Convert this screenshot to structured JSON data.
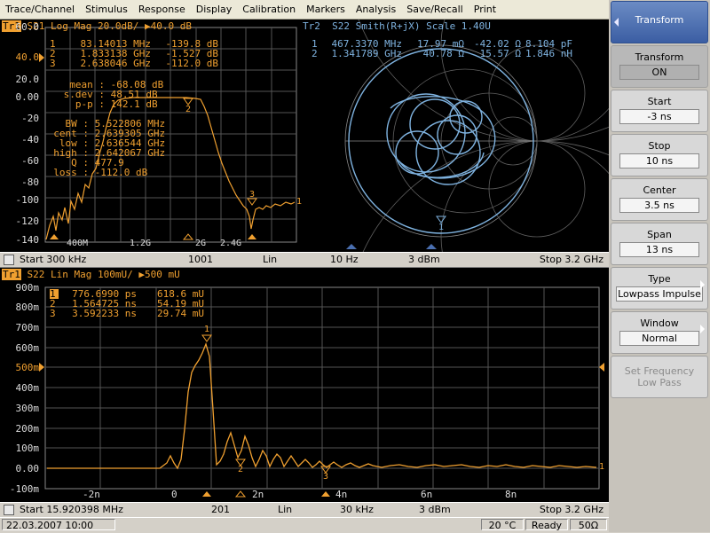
{
  "menu": [
    "Trace/Channel",
    "Stimulus",
    "Response",
    "Display",
    "Calibration",
    "Markers",
    "Analysis",
    "Save/Recall",
    "Print"
  ],
  "top": {
    "tr1_tag": "Tr1",
    "tr1_title": "S21 Log Mag 20.0dB/ ",
    "tr1_ref": "40.0 dB",
    "tr2_title": "Tr2  S22 Smith(R+jX) Scale 1.40U",
    "markers_left": [
      {
        "n": "1",
        "f": "83.14013 MHz",
        "v": "-139.8 dB"
      },
      {
        "n": "2",
        "f": "1.833138 GHz",
        "v": "-1.527 dB"
      },
      {
        "n": "3",
        "f": "2.638046 GHz",
        "v": "-112.0 dB"
      }
    ],
    "stats": [
      {
        "k": "mean :",
        "v": "-68.08 dB"
      },
      {
        "k": "s.dev :",
        "v": "48.51 dB"
      },
      {
        "k": "p-p :",
        "v": "142.1 dB"
      }
    ],
    "bw": [
      {
        "k": "BW :",
        "v": "5.522806 MHz"
      },
      {
        "k": "cent :",
        "v": "2.639305 GHz"
      },
      {
        "k": "low :",
        "v": "2.636544 GHz"
      },
      {
        "k": "high :",
        "v": "2.642067 GHz"
      },
      {
        "k": "Q :",
        "v": "477.9"
      },
      {
        "k": "loss :",
        "v": "-112.0 dB"
      }
    ],
    "markers_right": [
      {
        "n": "1",
        "f": "467.3370 MHz",
        "r": "17.97 mΩ",
        "x": "-42.02 Ω",
        "e": "8.104 pF"
      },
      {
        "n": "2",
        "f": "1.341789 GHz",
        "r": "40.78 Ω",
        "x": "15.57 Ω",
        "e": "1.846 nH"
      }
    ],
    "y_ticks": [
      "60.0",
      "40.0",
      "20.0",
      "0.00",
      "-20",
      "-40",
      "-60",
      "-80",
      "-100",
      "-120",
      "-140"
    ],
    "ref_label": "40.0",
    "x_ticks": [
      "400M",
      "1.2G",
      "2G",
      "2.4G"
    ],
    "status": {
      "start": "Start 300 kHz",
      "points": "1001",
      "sweep": "Lin",
      "ifbw": "10 Hz",
      "power": "3 dBm",
      "stop": "Stop 3.2 GHz"
    }
  },
  "bottom": {
    "tr1_tag": "Tr1",
    "title": "S22 Lin Mag 100mU/ ",
    "ref": "500 mU",
    "markers": [
      {
        "n": "1",
        "t": "776.6990 ps",
        "v": "618.6 mU"
      },
      {
        "n": "2",
        "t": "1.564725 ns",
        "v": "54.19 mU"
      },
      {
        "n": "3",
        "t": "3.592233 ns",
        "v": "29.74 mU"
      }
    ],
    "y_ticks": [
      "900m",
      "800m",
      "700m",
      "600m",
      "500m",
      "400m",
      "300m",
      "200m",
      "100m",
      "0.00",
      "-100m"
    ],
    "ref_label": "500m",
    "x_ticks": [
      "-2n",
      "0",
      "2n",
      "4n",
      "6n",
      "8n"
    ],
    "status": {
      "start": "Start 15.920398 MHz",
      "points": "201",
      "sweep": "Lin",
      "ifbw": "30 kHz",
      "power": "3 dBm",
      "stop": "Stop 3.2 GHz"
    }
  },
  "footer": {
    "date": "22.03.2007 10:00",
    "temp": "20 °C",
    "state": "Ready",
    "imp": "50Ω"
  },
  "softkeys": {
    "header": "Transform",
    "transform": {
      "label": "Transform",
      "value": "ON"
    },
    "start": {
      "label": "Start",
      "value": "-3 ns"
    },
    "stop": {
      "label": "Stop",
      "value": "10 ns"
    },
    "center": {
      "label": "Center",
      "value": "3.5 ns"
    },
    "span": {
      "label": "Span",
      "value": "13 ns"
    },
    "type": {
      "label": "Type",
      "value": "Lowpass Impulse"
    },
    "window": {
      "label": "Window",
      "value": "Normal"
    },
    "setfreq": {
      "label1": "Set Frequency",
      "label2": "Low Pass"
    }
  },
  "colors": {
    "trace1": "#f0a030",
    "trace2": "#7fb3e0",
    "text_top_left": "#f0a030",
    "text_top_right": "#7fb3e0",
    "grid": "#5a5a5a",
    "bg": "#000000"
  }
}
